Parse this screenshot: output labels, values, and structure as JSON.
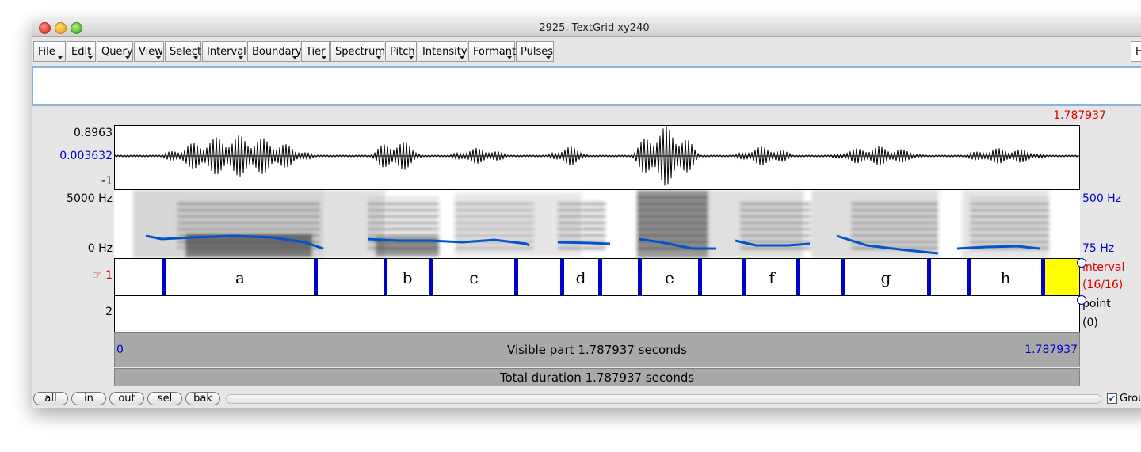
{
  "window": {
    "title": "2925. TextGrid xy240"
  },
  "menu": {
    "items": [
      {
        "label": "File"
      },
      {
        "label": "Edit"
      },
      {
        "label": "Query"
      },
      {
        "label": "View"
      },
      {
        "label": "Select"
      },
      {
        "label": "Interval"
      },
      {
        "label": "Boundary"
      },
      {
        "label": "Tier"
      },
      {
        "label": "Spectrum"
      },
      {
        "label": "Pitch"
      },
      {
        "label": "Intensity"
      },
      {
        "label": "Formant"
      },
      {
        "label": "Pulses"
      }
    ],
    "right_label": "H"
  },
  "cursor_time": "1.787937",
  "waveform": {
    "max": "0.8963",
    "cursor_value": "0.003632",
    "min": "-1"
  },
  "spectrogram": {
    "freq_top": "5000 Hz",
    "freq_bottom": "0 Hz",
    "pitch_top": "500 Hz",
    "pitch_bottom": "75 Hz",
    "pitch_color": "#0055cc"
  },
  "tier1": {
    "number": "1",
    "pointer_icon": "hand-pointer-icon",
    "side_label": "interval",
    "side_count": "(16/16)",
    "intervals": [
      {
        "label": "a"
      },
      {
        "label": "b"
      },
      {
        "label": "c"
      },
      {
        "label": "d"
      },
      {
        "label": "e"
      },
      {
        "label": "f"
      },
      {
        "label": "g"
      },
      {
        "label": "h"
      }
    ]
  },
  "tier2": {
    "number": "2",
    "side_label": "point",
    "side_count": "(0)"
  },
  "visible": {
    "start": "0",
    "label": "Visible part 1.787937 seconds",
    "end": "1.787937"
  },
  "total": {
    "label": "Total duration 1.787937 seconds"
  },
  "bottom_buttons": [
    {
      "label": "all"
    },
    {
      "label": "in"
    },
    {
      "label": "out"
    },
    {
      "label": "sel"
    },
    {
      "label": "bak"
    }
  ],
  "group_checkbox": {
    "label": "Group",
    "checked": true
  },
  "colors": {
    "boundary": "#0000cc",
    "selection": "#ffff00",
    "accent_red": "#dd0000"
  }
}
